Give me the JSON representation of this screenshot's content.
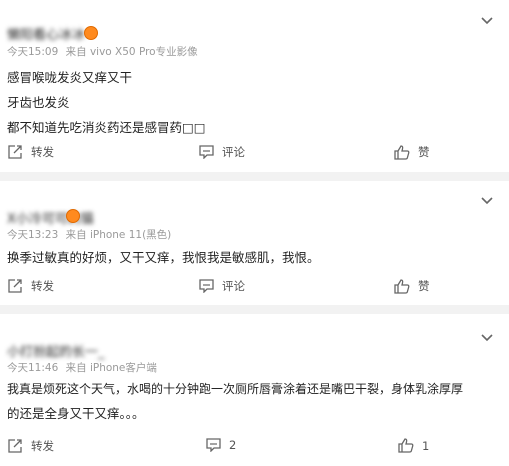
{
  "posts": [
    {
      "username": "懒阳看心冰冰",
      "time": "今天15:09",
      "source": "来自 vivo X50 Pro专业影像",
      "lines": [
        "感冒喉咙发炎又痒又干",
        "牙齿也发炎",
        "都不知道先吃消炎药还是感冒药□□"
      ],
      "actions": {
        "repost": "转发",
        "comment": "评论",
        "like": "赞"
      }
    },
    {
      "username": "X小冷可可的猫",
      "time": "今天13:23",
      "source": "来自 iPhone 11(黑色)",
      "lines": [
        "换季过敏真的好烦，又干又痒，我恨我是敏感肌，我恨。"
      ],
      "actions": {
        "repost": "转发",
        "comment": "评论",
        "like": "赞"
      }
    },
    {
      "username": "小打扮起的长一_",
      "time": "今天11:46",
      "source": "来自 iPhone客户端",
      "lines": [
        "我真是烦死这个天气，水喝的十分钟跑一次厕所唇膏涂着还是嘴巴干裂，身体乳涂厚厚",
        "的还是全身又干又痒。。。"
      ],
      "actions": {
        "repost": "转发",
        "comment": "2",
        "like": "1"
      }
    }
  ]
}
